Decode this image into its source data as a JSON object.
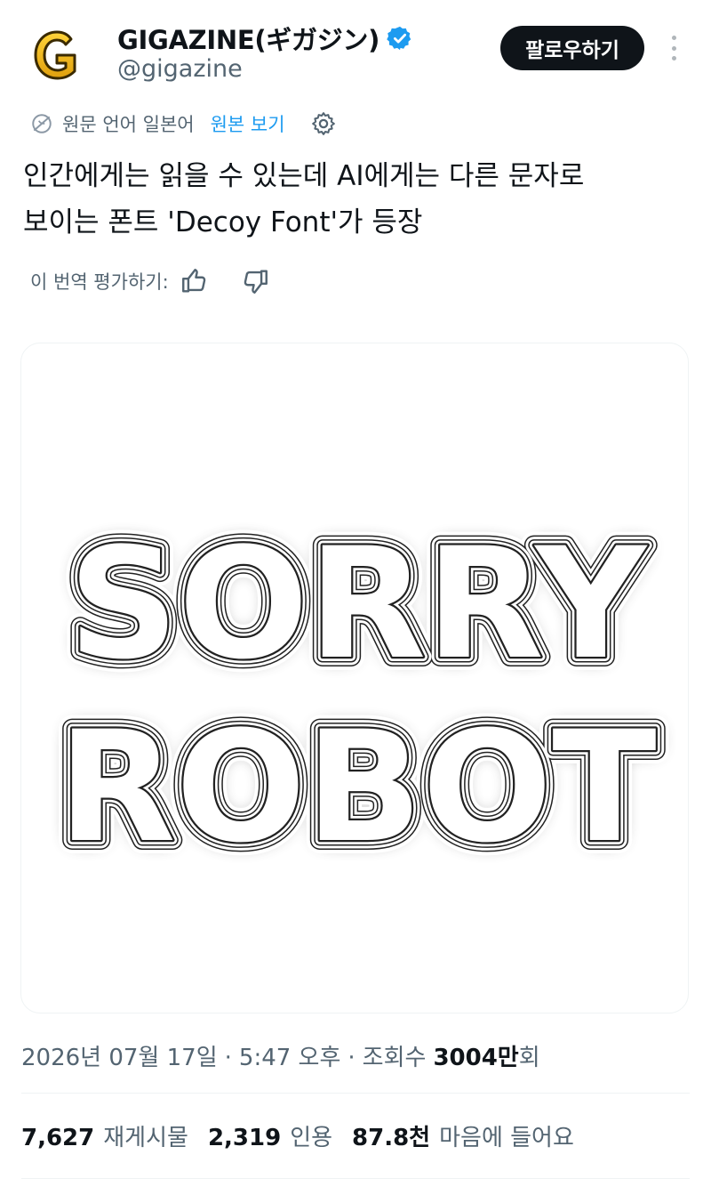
{
  "account": {
    "display_name": "GIGAZINE(ギガジン)",
    "handle": "@gigazine",
    "follow_label": "팔로우하기",
    "verified": true
  },
  "translation": {
    "source_language_text": "원문 언어 일본어",
    "view_original_label": "원본 보기",
    "rate_label": "이 번역 평가하기:"
  },
  "tweet": {
    "text_line1": "인간에게는 읽을 수 있는데 AI에게는 다른 문자로",
    "text_line2": "보이는 폰트 'Decoy Font'가 등장"
  },
  "media": {
    "line1": "SORRY",
    "line2": "ROBOT"
  },
  "meta": {
    "date": "2026년 07월 17일",
    "separator": "·",
    "time": "5:47 오후",
    "views_label": "조회수",
    "views_value": "3004만",
    "views_suffix": "회"
  },
  "stats": {
    "reposts_value": "7,627",
    "reposts_label": "재게시물",
    "quotes_value": "2,319",
    "quotes_label": "인용",
    "likes_value": "87.8천",
    "likes_label": "마음에 들어요"
  },
  "colors": {
    "text_primary": "#0f1419",
    "text_secondary": "#536471",
    "link": "#1d9bf0",
    "verified_blue": "#1d9bf0",
    "logo_yellow": "#f2b91a"
  },
  "icons": {
    "verified": "verified-badge-icon",
    "translate": "translate-icon",
    "settings": "gear-icon",
    "thumbs_up": "thumbs-up-icon",
    "thumbs_down": "thumbs-down-icon",
    "more": "more-dots-icon"
  }
}
